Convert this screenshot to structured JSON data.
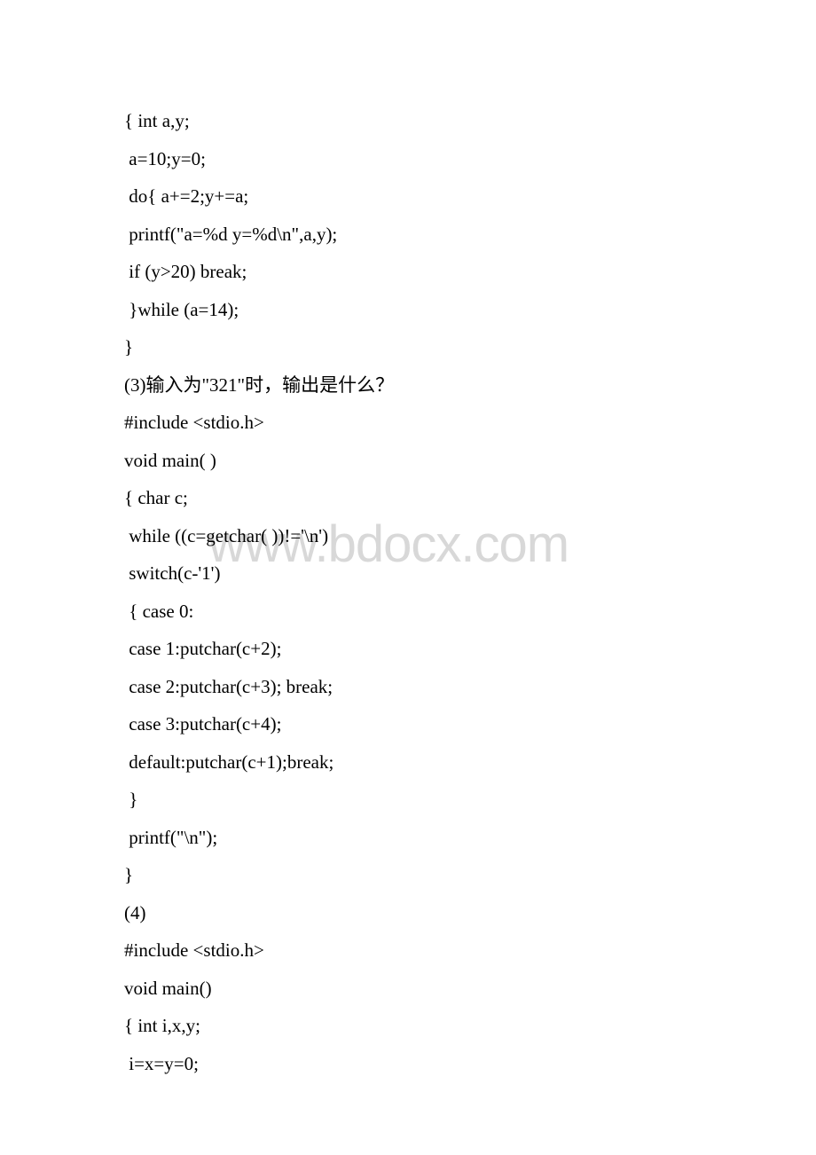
{
  "watermark": "www.bdocx.com",
  "lines": [
    "{ int a,y;",
    " a=10;y=0;",
    " do{ a+=2;y+=a;",
    " printf(\"a=%d y=%d\\n\",a,y);",
    " if (y>20) break;",
    " }while (a=14);",
    "}",
    "(3)输入为\"321\"时，输出是什么？",
    "#include <stdio.h>",
    "void main( )",
    "{ char c;",
    " while ((c=getchar( ))!='\\n')",
    " switch(c-'1')",
    " { case 0:",
    " case 1:putchar(c+2);",
    " case 2:putchar(c+3); break;",
    " case 3:putchar(c+4);",
    " default:putchar(c+1);break;",
    " }",
    " printf(\"\\n\");",
    "}",
    "(4)",
    "#include <stdio.h>",
    "void main()",
    "{ int i,x,y;",
    " i=x=y=0;"
  ]
}
